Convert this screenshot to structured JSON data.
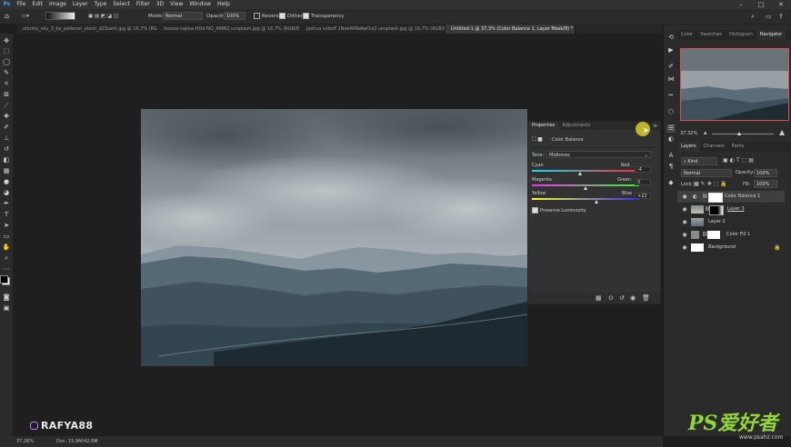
{
  "menu": [
    "File",
    "Edit",
    "Image",
    "Layer",
    "Type",
    "Select",
    "Filter",
    "3D",
    "View",
    "Window",
    "Help"
  ],
  "window_controls": [
    "–",
    "□",
    "✕"
  ],
  "options_bar": {
    "mode_label": "Mode:",
    "mode_value": "Normal",
    "opacity_label": "Opacity:",
    "opacity_value": "100%",
    "reverse_label": "Reverse",
    "dither_label": "Dither",
    "transparency_label": "Transparency"
  },
  "tabs": [
    {
      "label": "stormy_sky_3_by_pelleron_stock_d23serk.jpg @ 16,7% (RGB/8)",
      "active": false
    },
    {
      "label": "hoosie-cajina-HDd NQ_AMBQ unsplash.jpg @ 16,7% (RGB/8)",
      "active": false
    },
    {
      "label": "joshua sokoff 1NoeW4bAwOuQ unsplash.jpg @ 16,7% (RGB/8)",
      "active": false
    },
    {
      "label": "Untitled-1 @ 37,3% (Color Balance 1, Layer Mask/8) *",
      "active": true
    }
  ],
  "properties": {
    "tab_properties": "Properties",
    "tab_adjustments": "Adjustments",
    "panel_title": "Color Balance",
    "tone_label": "Tone:",
    "tone_value": "Midtones",
    "sliders": [
      {
        "left": "Cyan",
        "right": "Red",
        "value": "-4"
      },
      {
        "left": "Magenta",
        "right": "Green",
        "value": "0"
      },
      {
        "left": "Yellow",
        "right": "Blue",
        "value": "+22"
      }
    ],
    "preserve_luminosity": "Preserve Luminosity"
  },
  "navigator": {
    "tabs": [
      "Color",
      "Swatches",
      "Histogram",
      "Navigator"
    ],
    "active_tab": "Navigator",
    "zoom": "37,32%"
  },
  "layers_panel": {
    "tabs": [
      "Layers",
      "Channels",
      "Paths"
    ],
    "kind_label": "Kind",
    "blend_mode": "Normal",
    "opacity_label": "Opacity:",
    "opacity_value": "100%",
    "lock_label": "Lock:",
    "fill_label": "Fill:",
    "fill_value": "100%",
    "layers": [
      {
        "name": "Color Balance 1",
        "selected": true
      },
      {
        "name": "Layer 3",
        "selected": false
      },
      {
        "name": "Layer 2",
        "selected": false
      },
      {
        "name": "Color Fill 1",
        "selected": false
      },
      {
        "name": "Background",
        "selected": false
      }
    ]
  },
  "status_bar": {
    "zoom": "37,26%",
    "doc": "Doc: 15,9M/42,8M"
  },
  "watermark": "RAFYA88",
  "site_logo_text": "PS爱好者",
  "site_url": "www.psahz.com",
  "colors": {
    "accent_red": "#d9534f",
    "ui_dark": "#2b2b2b",
    "cursor_yellow": "#d8cf2a"
  }
}
